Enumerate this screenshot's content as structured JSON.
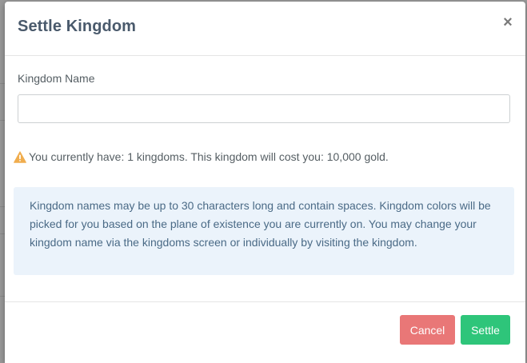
{
  "modal": {
    "title": "Settle Kingdom",
    "close_symbol": "×",
    "close_icon": "close-icon"
  },
  "form": {
    "name_label": "Kingdom Name",
    "name_value": "",
    "name_placeholder": ""
  },
  "warning": {
    "icon": "warning-icon",
    "icon_color": "#f0ad4e",
    "text": "You currently have: 1 kingdoms. This kingdom will cost you: 10,000 gold."
  },
  "info": {
    "text": "Kingdom names may be up to 30 characters long and contain spaces. Kingdom colors will be picked for you based on the plane of existence you are currently on. You may change your kingdom name via the kingdoms screen or individually by visiting the kingdom."
  },
  "footer": {
    "cancel_label": "Cancel",
    "settle_label": "Settle"
  },
  "colors": {
    "cancel": "#e97777",
    "settle": "#2ec57a",
    "info_background": "#ebf3fb",
    "title": "#4a5a6c"
  }
}
